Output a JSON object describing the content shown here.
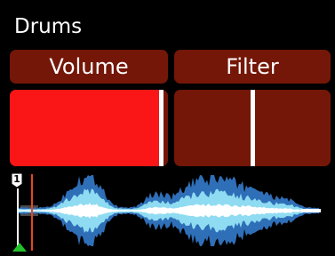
{
  "track": {
    "name": "Drums"
  },
  "tabs": {
    "volume_label": "Volume",
    "filter_label": "Filter"
  },
  "controls": {
    "volume_level": 0.97,
    "filter_level": 0.5
  },
  "waveform": {
    "marker_number": "1"
  },
  "colors": {
    "background": "#000000",
    "tab_bg": "#741708",
    "volume_fill": "#fa1616",
    "filter_bg": "#741708",
    "wave_outer": "#2f6fb8",
    "wave_mid": "#8fdcf2",
    "wave_core": "#ffffff",
    "playhead": "#e8461f",
    "marker_green": "#22c02a"
  },
  "icons": {
    "marker_flag": "flag-marker-icon",
    "start_marker": "triangle-up-icon"
  }
}
